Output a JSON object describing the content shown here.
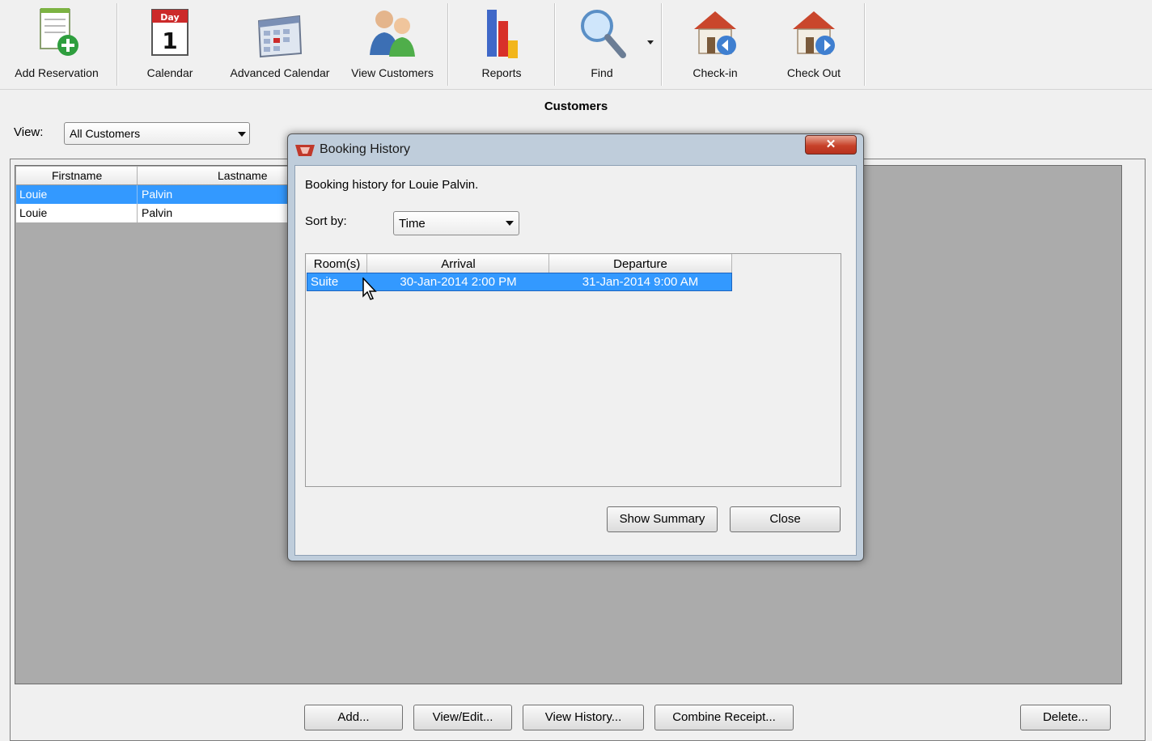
{
  "toolbar": {
    "items": [
      {
        "label": "Add Reservation",
        "icon": "add-reservation-icon"
      },
      {
        "label": "Calendar",
        "icon": "calendar-icon",
        "icon_text_day": "Day",
        "icon_text_num": "1"
      },
      {
        "label": "Advanced Calendar",
        "icon": "advanced-calendar-icon"
      },
      {
        "label": "View Customers",
        "icon": "customers-icon"
      },
      {
        "label": "Reports",
        "icon": "reports-icon"
      },
      {
        "label": "Find",
        "icon": "magnifier-icon"
      },
      {
        "label": "Check-in",
        "icon": "checkin-house-icon"
      },
      {
        "label": "Check Out",
        "icon": "checkout-house-icon"
      }
    ]
  },
  "page": {
    "title": "Customers",
    "view_label": "View:",
    "view_value": "All Customers"
  },
  "customers": {
    "headers": [
      "Firstname",
      "Lastname"
    ],
    "rows": [
      {
        "first": "Louie",
        "last": "Palvin",
        "selected": true
      },
      {
        "first": "Louie",
        "last": "Palvin",
        "selected": false
      }
    ]
  },
  "bottom_buttons": {
    "add": "Add...",
    "view_edit": "View/Edit...",
    "view_history": "View History...",
    "combine_receipt": "Combine Receipt...",
    "delete": "Delete..."
  },
  "dialog": {
    "title": "Booking History",
    "close_glyph": "✕",
    "description": "Booking history for Louie Palvin.",
    "sort_label": "Sort by:",
    "sort_value": "Time",
    "headers": [
      "Room(s)",
      "Arrival",
      "Departure"
    ],
    "rows": [
      {
        "room": "Suite",
        "arrival": "30-Jan-2014 2:00 PM",
        "departure": "31-Jan-2014 9:00 AM",
        "selected": true
      }
    ],
    "show_summary": "Show Summary",
    "close": "Close"
  },
  "colors": {
    "selection": "#3399ff",
    "list_background": "#ababab",
    "dialog_frame": "#bfcddb",
    "close_button": "#c7422a"
  }
}
